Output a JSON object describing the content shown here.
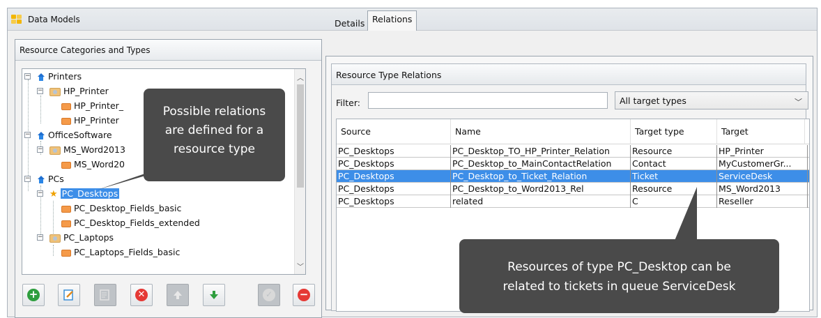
{
  "window": {
    "title": "Data Models"
  },
  "left_panel": {
    "header": "Resource Categories and Types",
    "tree": [
      {
        "label": "Printers",
        "kind": "category"
      },
      {
        "label": "HP_Printer",
        "kind": "type"
      },
      {
        "label": "HP_Printer_",
        "kind": "field"
      },
      {
        "label": "HP_Printer",
        "kind": "field"
      },
      {
        "label": "OfficeSoftware",
        "kind": "category"
      },
      {
        "label": "MS_Word2013",
        "kind": "type"
      },
      {
        "label": "MS_Word20",
        "kind": "field"
      },
      {
        "label": "PCs",
        "kind": "category"
      },
      {
        "label": "PC_Desktops",
        "kind": "type-selected"
      },
      {
        "label": "PC_Desktop_Fields_basic",
        "kind": "field"
      },
      {
        "label": "PC_Desktop_Fields_extended",
        "kind": "field"
      },
      {
        "label": "PC_Laptops",
        "kind": "type"
      },
      {
        "label": "PC_Laptops_Fields_basic",
        "kind": "field"
      }
    ],
    "toolbar": [
      "add-icon",
      "edit-icon",
      "edit-fields-icon",
      "delete-icon",
      "move-up-icon",
      "move-down-icon",
      "check-icon",
      "remove-icon"
    ]
  },
  "right_panel": {
    "tabs": [
      "Details",
      "Relations"
    ],
    "active_tab": "Relations",
    "section_title": "Resource Type Relations",
    "filter_label": "Filter:",
    "filter_value": "",
    "target_select": "All target types",
    "columns": [
      "Source",
      "Name",
      "Target type",
      "Target"
    ],
    "rows": [
      [
        "PC_Desktops",
        "PC_Desktop_TO_HP_Printer_Relation",
        "Resource",
        "HP_Printer"
      ],
      [
        "PC_Desktops",
        "PC_Desktop_to_MainContactRelation",
        "Contact",
        "MyCustomerGr..."
      ],
      [
        "PC_Desktops",
        "PC_Desktop_to_Ticket_Relation",
        "Ticket",
        "ServiceDesk"
      ],
      [
        "PC_Desktops",
        "PC_Desktop_to_Word2013_Rel",
        "Resource",
        "MS_Word2013"
      ],
      [
        "PC_Desktops",
        "related",
        "C",
        "Reseller"
      ]
    ],
    "selected_row": 2
  },
  "callouts": {
    "left": [
      "Possible relations",
      "are defined for a",
      "resource type"
    ],
    "right": [
      "Resources of type PC_Desktop can be",
      "related to tickets in queue ServiceDesk"
    ]
  },
  "colors": {
    "selection": "#3d8ee8",
    "callout_bg": "#4a4a4a",
    "add": "#2e9e3e",
    "delete": "#e53935"
  }
}
